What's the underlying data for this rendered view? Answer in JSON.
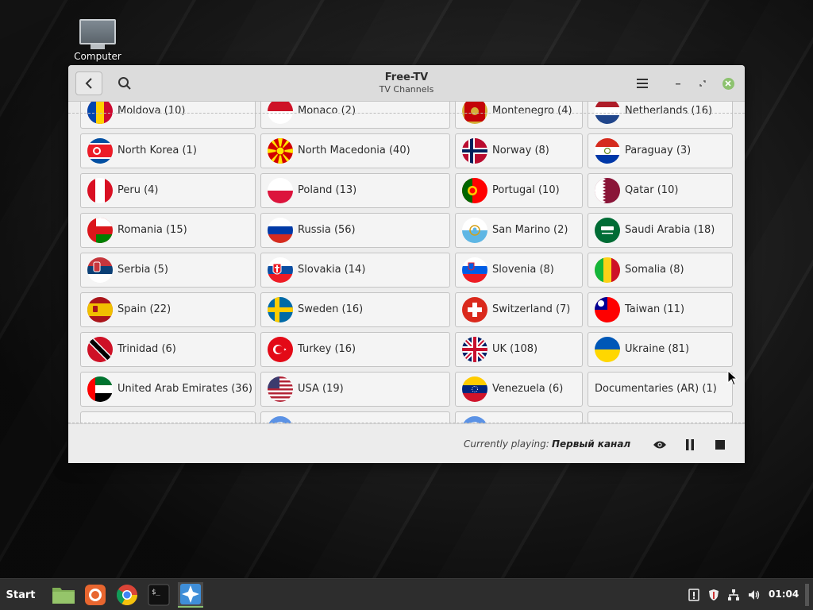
{
  "desktop": {
    "icon_label": "Computer"
  },
  "window": {
    "title": "Free-TV",
    "subtitle": "TV Channels"
  },
  "channels": [
    {
      "label": "Moldova (10)",
      "flag": "moldova-flag"
    },
    {
      "label": "Monaco (2)",
      "flag": "monaco-flag"
    },
    {
      "label": "Montenegro (4)",
      "flag": "montenegro-flag"
    },
    {
      "label": "Netherlands (16)",
      "flag": "netherlands-flag"
    },
    {
      "label": "North Korea (1)",
      "flag": "north-korea-flag"
    },
    {
      "label": "North Macedonia (40)",
      "flag": "north-macedonia-flag"
    },
    {
      "label": "Norway (8)",
      "flag": "norway-flag"
    },
    {
      "label": "Paraguay (3)",
      "flag": "paraguay-flag"
    },
    {
      "label": "Peru (4)",
      "flag": "peru-flag"
    },
    {
      "label": "Poland (13)",
      "flag": "poland-flag"
    },
    {
      "label": "Portugal (10)",
      "flag": "portugal-flag"
    },
    {
      "label": "Qatar (10)",
      "flag": "qatar-flag"
    },
    {
      "label": "Romania (15)",
      "flag": "oman-flag"
    },
    {
      "label": "Russia (56)",
      "flag": "russia-flag"
    },
    {
      "label": "San Marino (2)",
      "flag": "san-marino-flag"
    },
    {
      "label": "Saudi Arabia (18)",
      "flag": "saudi-arabia-flag"
    },
    {
      "label": "Serbia (5)",
      "flag": "serbia-flag"
    },
    {
      "label": "Slovakia (14)",
      "flag": "slovakia-flag"
    },
    {
      "label": "Slovenia (8)",
      "flag": "slovenia-flag"
    },
    {
      "label": "Somalia (8)",
      "flag": "mali-flag"
    },
    {
      "label": "Spain (22)",
      "flag": "spain-flag"
    },
    {
      "label": "Sweden (16)",
      "flag": "sweden-flag"
    },
    {
      "label": "Switzerland (7)",
      "flag": "switzerland-flag"
    },
    {
      "label": "Taiwan (11)",
      "flag": "taiwan-flag"
    },
    {
      "label": "Trinidad (6)",
      "flag": "trinidad-flag"
    },
    {
      "label": "Turkey (16)",
      "flag": "turkey-flag"
    },
    {
      "label": "UK (108)",
      "flag": "uk-flag"
    },
    {
      "label": "Ukraine (81)",
      "flag": "ukraine-flag"
    },
    {
      "label": "United Arab Emirates (36)",
      "flag": "uae-flag"
    },
    {
      "label": "USA (19)",
      "flag": "usa-flag"
    },
    {
      "label": "Venezuela (6)",
      "flag": "venezuela-flag"
    },
    {
      "label": "Documentaries (AR) (1)",
      "flag": ""
    }
  ],
  "player": {
    "currently_playing_label": "Currently playing:",
    "channel_name": "Первый канал"
  },
  "taskbar": {
    "start_label": "Start",
    "clock": "01:04",
    "apps": [
      "files-icon",
      "firefox-icon",
      "chrome-icon",
      "terminal-icon",
      "freetv-icon"
    ]
  },
  "colors": {
    "accent": "#8dc26f",
    "window_bg": "#ececec",
    "titlebar_bg": "#dcdcdc",
    "taskbar_bg": "#2d2d2d"
  }
}
